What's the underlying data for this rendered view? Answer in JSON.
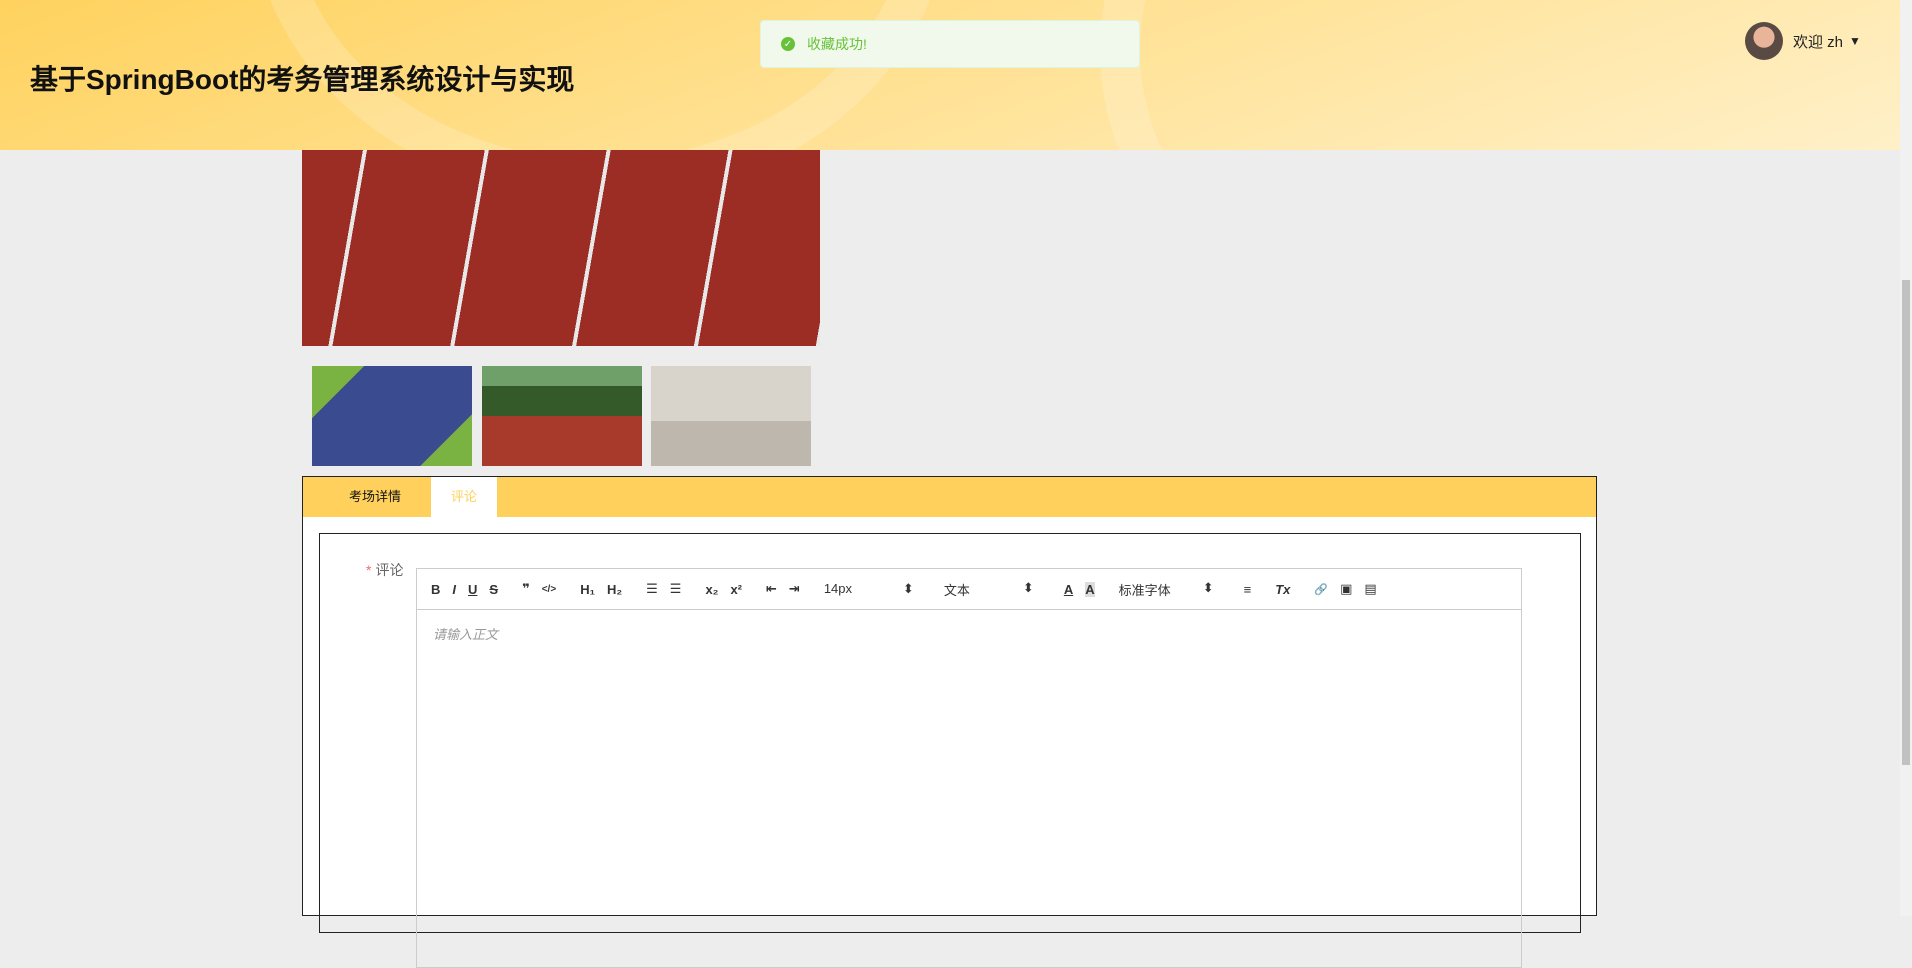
{
  "header": {
    "title": "基于SpringBoot的考务管理系统设计与实现",
    "welcome": "欢迎 zh",
    "caret": "▼"
  },
  "toast": {
    "message": "收藏成功!",
    "icon": "✓"
  },
  "tabs": [
    {
      "label": "考场详情"
    },
    {
      "label": "评论"
    }
  ],
  "form": {
    "required_mark": "*",
    "label": "评论",
    "placeholder": "请输入正文"
  },
  "toolbar": {
    "bold": "B",
    "italic": "I",
    "underline": "U",
    "strike": "S",
    "quote": "❞",
    "code": "</>",
    "h1": "H₁",
    "h2": "H₂",
    "ol": "☰",
    "ul": "☰",
    "sub": "x₂",
    "sup": "x²",
    "outdent": "⇤",
    "indent": "⇥",
    "size": "14px",
    "header": "文本",
    "color": "A",
    "bg": "A",
    "font": "标准字体",
    "align": "≡",
    "clean": "Tx",
    "link": "🔗",
    "image": "▣",
    "video": "▤",
    "arrows": "⬍"
  }
}
